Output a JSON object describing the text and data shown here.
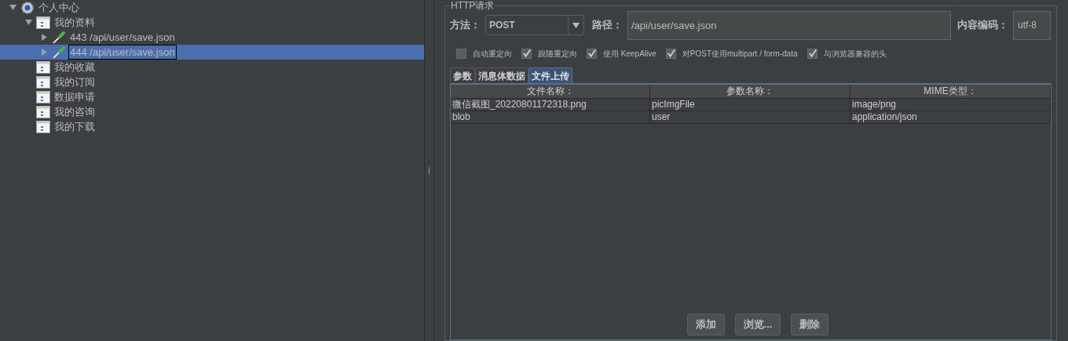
{
  "tree": [
    {
      "label": "个人中心",
      "kind": "gear",
      "expanded": true,
      "selected": false,
      "children": [
        {
          "label": "我的资料",
          "kind": "page",
          "expanded": true,
          "selected": false,
          "children": [
            {
              "label": "443 /api/user/save.json",
              "kind": "sampler",
              "expanded": false,
              "selected": false
            },
            {
              "label": "444 /api/user/save.json",
              "kind": "sampler",
              "expanded": false,
              "selected": true
            }
          ]
        },
        {
          "label": "我的收藏",
          "kind": "page",
          "selected": false
        },
        {
          "label": "我的订阅",
          "kind": "page",
          "selected": false
        },
        {
          "label": "数据申请",
          "kind": "page",
          "selected": false
        },
        {
          "label": "我的咨询",
          "kind": "page",
          "selected": false
        },
        {
          "label": "我的下载",
          "kind": "page",
          "selected": false
        }
      ]
    }
  ],
  "group_title": "HTTP请求",
  "method": {
    "label": "方法：",
    "value": "POST"
  },
  "path": {
    "label": "路径：",
    "value": "/api/user/save.json"
  },
  "encoding": {
    "label": "内容编码：",
    "value": "utf-8"
  },
  "options": [
    {
      "label": "自动重定向",
      "checked": false
    },
    {
      "label": "跟随重定向",
      "checked": true
    },
    {
      "label": "使用 KeepAlive",
      "checked": true
    },
    {
      "label": "对POST使用multipart / form-data",
      "checked": true
    },
    {
      "label": "与浏览器兼容的头",
      "checked": true
    }
  ],
  "tabs": [
    {
      "label": "参数",
      "selected": false
    },
    {
      "label": "消息体数据",
      "selected": false
    },
    {
      "label": "文件上传",
      "selected": true
    }
  ],
  "table": {
    "columns": [
      "文件名称：",
      "参数名称：",
      "MIME类型："
    ],
    "rows": [
      [
        "微信截图_20220801172318.png",
        "picImgFile",
        "image/png"
      ],
      [
        "blob",
        "user",
        "application/json"
      ]
    ]
  },
  "buttons": [
    "添加",
    "浏览...",
    "删除"
  ]
}
